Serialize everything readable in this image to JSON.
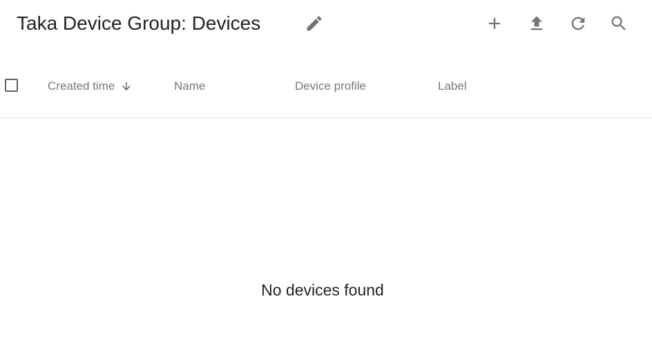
{
  "toolbar": {
    "title": "Taka Device Group: Devices",
    "actions": [
      {
        "name": "edit",
        "icon": "edit-icon"
      },
      {
        "name": "add",
        "icon": "add-icon"
      },
      {
        "name": "upload",
        "icon": "upload-icon"
      },
      {
        "name": "refresh",
        "icon": "refresh-icon"
      },
      {
        "name": "search",
        "icon": "search-icon"
      }
    ]
  },
  "table": {
    "select_all_checked": false,
    "columns": [
      {
        "label": "Created time",
        "sort": "desc"
      },
      {
        "label": "Name"
      },
      {
        "label": "Device profile"
      },
      {
        "label": "Label"
      }
    ],
    "rows": [],
    "empty_message": "No devices found"
  },
  "colors": {
    "icon": "#757575",
    "divider": "#e0e0e0",
    "header_text": "rgba(0,0,0,0.54)"
  }
}
